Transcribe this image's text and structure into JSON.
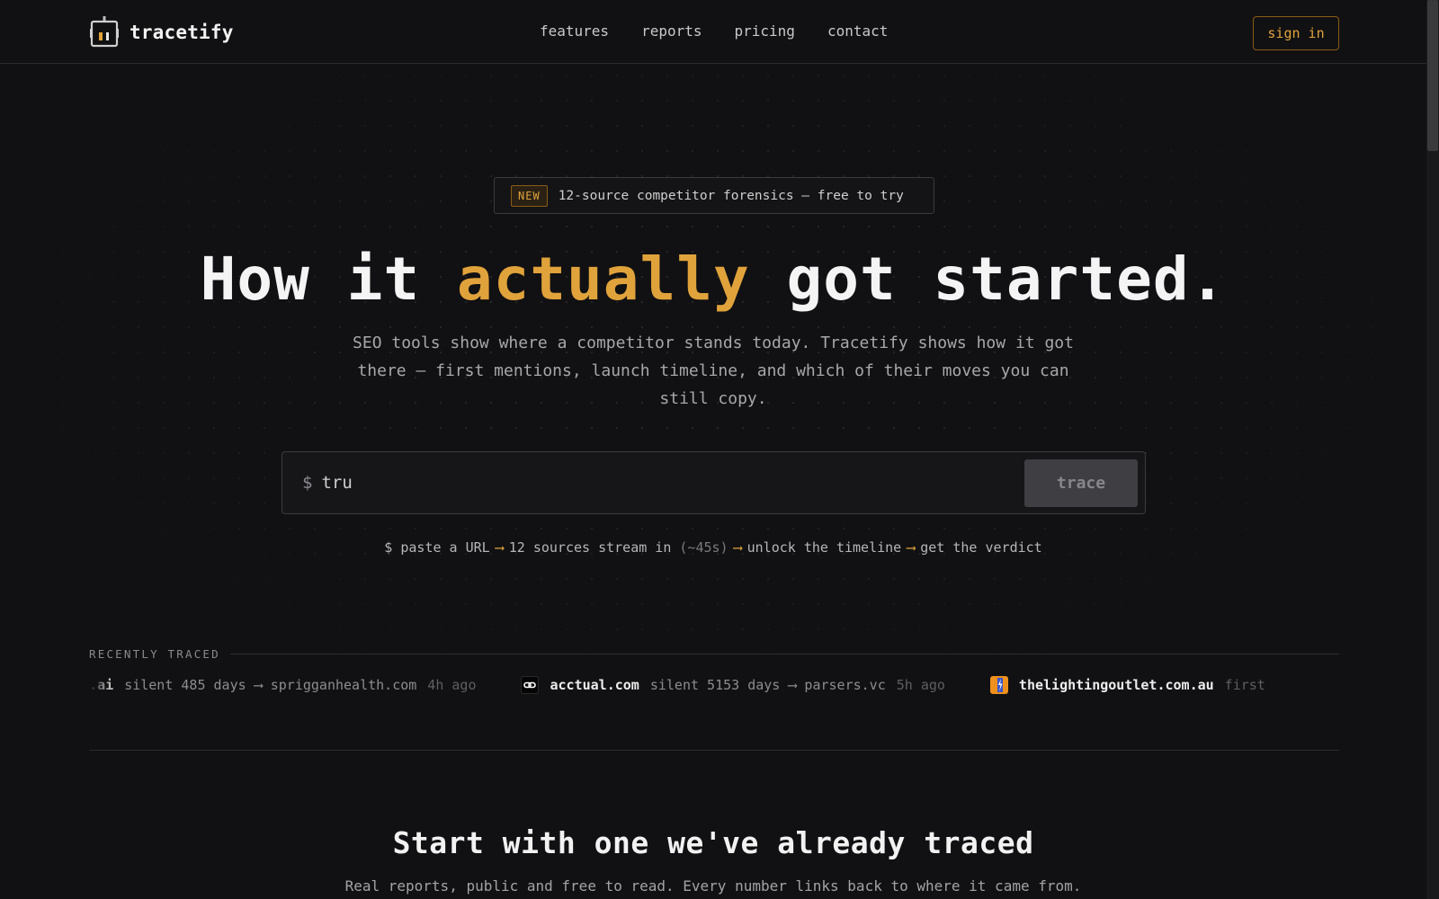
{
  "header": {
    "brand": "tracetify",
    "nav": [
      "features",
      "reports",
      "pricing",
      "contact"
    ],
    "signin_label": "sign in"
  },
  "hero": {
    "badge_tag": "NEW",
    "badge_text": "12-source competitor forensics — free to try",
    "title_before": "How it",
    "title_accent": "actually",
    "title_after": "got started.",
    "subtitle": "SEO tools show where a competitor stands today. Tracetify shows how it got there — first mentions, launch timeline, and which of their moves you can still copy."
  },
  "search": {
    "prompt": "$",
    "value": "tru",
    "button_label": "trace"
  },
  "steps": {
    "s1": "$ paste a URL",
    "arrow": "⟶",
    "s2": "12 sources stream in",
    "s2_note": "(~45s)",
    "s3": "unlock the timeline",
    "s4": "get the verdict"
  },
  "recent": {
    "label": "RECENTLY TRACED",
    "items": [
      {
        "domain": "sprigganhealth.ai",
        "shown_domain": "gan.ai",
        "meta": "silent 485 days ⟶ sprigganhealth.com",
        "ago": "4h ago"
      },
      {
        "domain": "acctual.com",
        "meta": "silent 5153 days ⟶ parsers.vc",
        "ago": "5h ago",
        "icon": "link-icon"
      },
      {
        "domain": "thelightingoutlet.com.au",
        "meta": "first",
        "ago": "",
        "icon": "lightning-icon"
      }
    ]
  },
  "section": {
    "title": "Start with one we've already traced",
    "subtitle": "Real reports, public and free to read. Every number links back to where it came from."
  },
  "colors": {
    "accent": "#e0a23b",
    "background": "#111113"
  }
}
